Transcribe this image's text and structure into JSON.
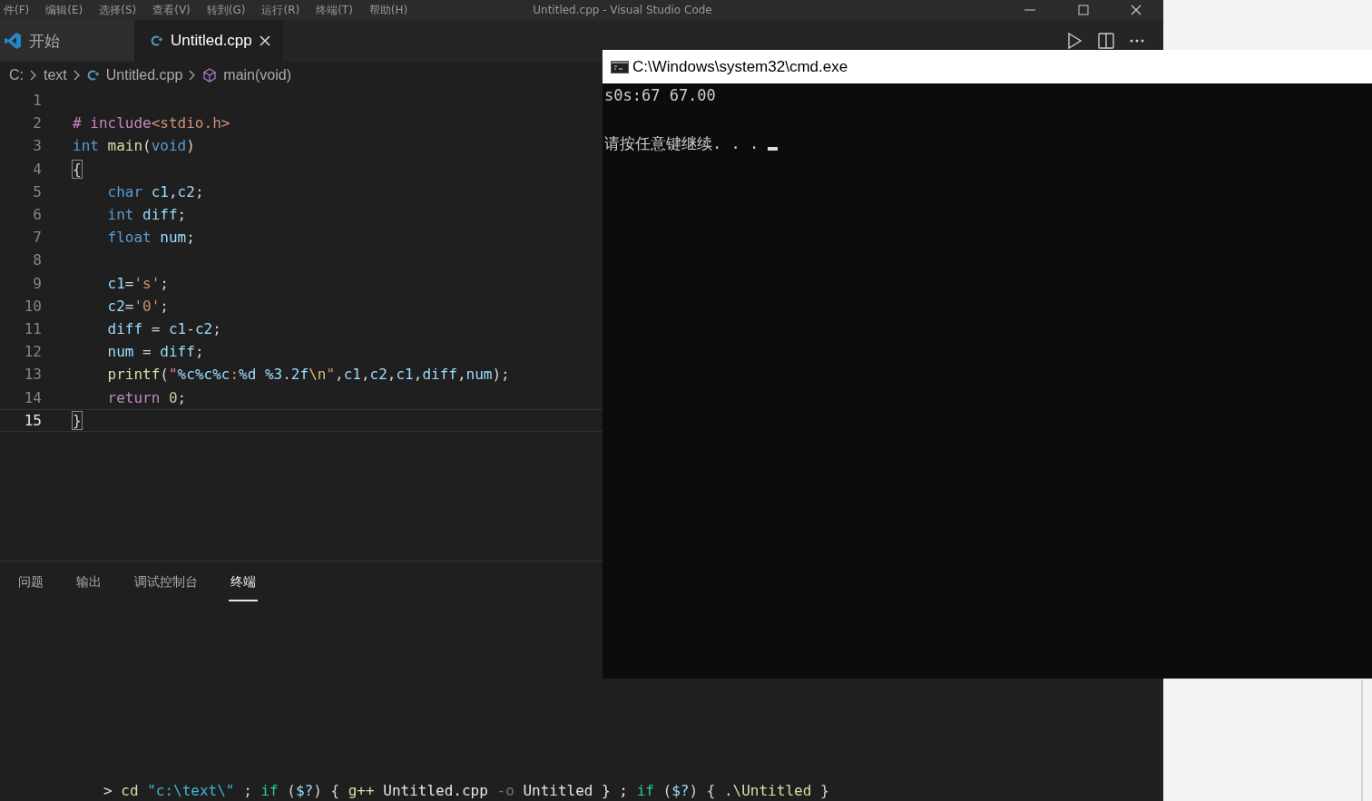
{
  "menu_bar": {
    "items": [
      "件(F)",
      "编辑(E)",
      "选择(S)",
      "查看(V)",
      "转到(G)",
      "运行(R)",
      "终端(T)",
      "帮助(H)"
    ],
    "title": "Untitled.cpp - Visual Studio Code"
  },
  "tabs": [
    {
      "label": "开始",
      "selected": false,
      "kind": "welcome"
    },
    {
      "label": "Untitled.cpp",
      "selected": true,
      "kind": "file"
    }
  ],
  "breadcrumbs": [
    {
      "label": "C:",
      "kind": "plain"
    },
    {
      "label": "text",
      "kind": "plain"
    },
    {
      "label": "Untitled.cpp",
      "kind": "file"
    },
    {
      "label": "main(void)",
      "kind": "symbol"
    }
  ],
  "editor": {
    "lines": [
      {
        "number": "1",
        "current": false
      },
      {
        "number": "2",
        "current": false,
        "indent": false,
        "tokens": [
          {
            "text": "# include",
            "kind": "preproc"
          },
          {
            "text": "<stdio.h>",
            "kind": "string"
          }
        ]
      },
      {
        "number": "3",
        "current": false,
        "indent": false,
        "tokens": [
          {
            "text": "int ",
            "kind": "type"
          },
          {
            "text": "main",
            "kind": "func"
          },
          {
            "text": "(",
            "kind": "plain"
          },
          {
            "text": "void",
            "kind": "type"
          },
          {
            "text": ")",
            "kind": "plain"
          }
        ]
      },
      {
        "number": "4",
        "current": false,
        "indent": false,
        "tokens": [
          {
            "text": "{",
            "kind": "bracket"
          }
        ]
      },
      {
        "number": "5",
        "current": false,
        "indent": true,
        "tokens": [
          {
            "text": "char",
            "kind": "type"
          },
          {
            "text": " c1",
            "kind": "var"
          },
          {
            "text": ",",
            "kind": "plain"
          },
          {
            "text": "c2",
            "kind": "var"
          },
          {
            "text": ";",
            "kind": "plain"
          }
        ]
      },
      {
        "number": "6",
        "current": false,
        "indent": true,
        "tokens": [
          {
            "text": "int",
            "kind": "type"
          },
          {
            "text": " diff",
            "kind": "var"
          },
          {
            "text": ";",
            "kind": "plain"
          }
        ]
      },
      {
        "number": "7",
        "current": false,
        "indent": true,
        "tokens": [
          {
            "text": "float",
            "kind": "type"
          },
          {
            "text": " num",
            "kind": "var"
          },
          {
            "text": ";",
            "kind": "plain"
          }
        ]
      },
      {
        "number": "8",
        "current": false
      },
      {
        "number": "9",
        "current": false,
        "indent": true,
        "tokens": [
          {
            "text": "c1",
            "kind": "var"
          },
          {
            "text": "=",
            "kind": "plain"
          },
          {
            "text": "'s'",
            "kind": "string"
          },
          {
            "text": ";",
            "kind": "plain"
          }
        ]
      },
      {
        "number": "10",
        "current": false,
        "indent": true,
        "tokens": [
          {
            "text": "c2",
            "kind": "var"
          },
          {
            "text": "=",
            "kind": "plain"
          },
          {
            "text": "'0'",
            "kind": "string"
          },
          {
            "text": ";",
            "kind": "plain"
          }
        ]
      },
      {
        "number": "11",
        "current": false,
        "indent": true,
        "tokens": [
          {
            "text": "diff",
            "kind": "var"
          },
          {
            "text": " = ",
            "kind": "plain"
          },
          {
            "text": "c1",
            "kind": "var"
          },
          {
            "text": "-",
            "kind": "plain"
          },
          {
            "text": "c2",
            "kind": "var"
          },
          {
            "text": ";",
            "kind": "plain"
          }
        ]
      },
      {
        "number": "12",
        "current": false,
        "indent": true,
        "tokens": [
          {
            "text": "num",
            "kind": "var"
          },
          {
            "text": " = ",
            "kind": "plain"
          },
          {
            "text": "diff",
            "kind": "var"
          },
          {
            "text": ";",
            "kind": "plain"
          }
        ]
      },
      {
        "number": "13",
        "current": false,
        "indent": true,
        "tokens": [
          {
            "text": "printf",
            "kind": "func"
          },
          {
            "text": "(",
            "kind": "plain"
          },
          {
            "text": "\"",
            "kind": "string"
          },
          {
            "text": "%c%c%c",
            "kind": "var"
          },
          {
            "text": ":",
            "kind": "string"
          },
          {
            "text": "%d ",
            "kind": "var"
          },
          {
            "text": "%3.2f",
            "kind": "var"
          },
          {
            "text": "\\n",
            "kind": "escape"
          },
          {
            "text": "\"",
            "kind": "string"
          },
          {
            "text": ",",
            "kind": "plain"
          },
          {
            "text": "c1",
            "kind": "var"
          },
          {
            "text": ",",
            "kind": "plain"
          },
          {
            "text": "c2",
            "kind": "var"
          },
          {
            "text": ",",
            "kind": "plain"
          },
          {
            "text": "c1",
            "kind": "var"
          },
          {
            "text": ",",
            "kind": "plain"
          },
          {
            "text": "diff",
            "kind": "var"
          },
          {
            "text": ",",
            "kind": "plain"
          },
          {
            "text": "num",
            "kind": "var"
          },
          {
            "text": ");",
            "kind": "plain"
          }
        ]
      },
      {
        "number": "14",
        "current": false,
        "indent": true,
        "tokens": [
          {
            "text": "return ",
            "kind": "keyword"
          },
          {
            "text": "0",
            "kind": "number"
          },
          {
            "text": ";",
            "kind": "plain"
          }
        ]
      },
      {
        "number": "15",
        "current": true,
        "indent": false,
        "tokens": [
          {
            "text": "}",
            "kind": "bracket"
          }
        ]
      }
    ]
  },
  "panel": {
    "tabs": [
      {
        "label": "问题",
        "selected": false
      },
      {
        "label": "输出",
        "selected": false
      },
      {
        "label": "调试控制台",
        "selected": false
      },
      {
        "label": "终端",
        "selected": true
      }
    ],
    "terminal_line": [
      {
        "text": "> ",
        "kind": "plain"
      },
      {
        "text": "cd ",
        "kind": "func"
      },
      {
        "text": "\"c:\\text\\\"",
        "kind": "cyan"
      },
      {
        "text": " ; ",
        "kind": "plain"
      },
      {
        "text": "if",
        "kind": "keyword2"
      },
      {
        "text": " (",
        "kind": "plain"
      },
      {
        "text": "$?",
        "kind": "var"
      },
      {
        "text": ") { ",
        "kind": "plain"
      },
      {
        "text": "g++",
        "kind": "func"
      },
      {
        "text": " Untitled.cpp ",
        "kind": "white"
      },
      {
        "text": "-o",
        "kind": "dim"
      },
      {
        "text": " Untitled } ; ",
        "kind": "white"
      },
      {
        "text": "if",
        "kind": "keyword2"
      },
      {
        "text": " (",
        "kind": "plain"
      },
      {
        "text": "$?",
        "kind": "var"
      },
      {
        "text": ") { ",
        "kind": "plain"
      },
      {
        "text": ".\\Untitled",
        "kind": "func"
      },
      {
        "text": " }",
        "kind": "plain"
      }
    ]
  },
  "console_window": {
    "title": "C:\\Windows\\system32\\cmd.exe",
    "lines": [
      "s0s:67 67.00",
      "请按任意键继续. . . "
    ],
    "cursor": true
  }
}
